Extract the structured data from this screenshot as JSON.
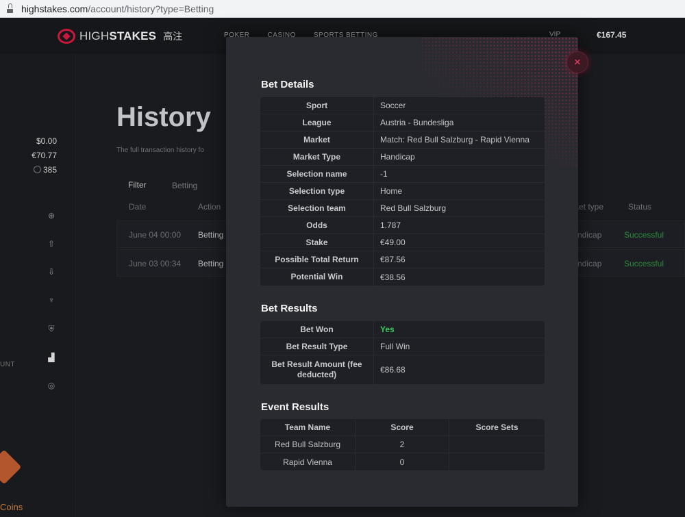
{
  "browser": {
    "url_host": "highstakes.com",
    "url_path": "/account/history?type=Betting"
  },
  "brand": {
    "name_light": "HIGH",
    "name_bold": "STAKES",
    "name_cn": "高注"
  },
  "nav": {
    "items": [
      "POKER",
      "CASINO",
      "SPORTS BETTING"
    ],
    "vip": "VIP",
    "balance": "€167.45"
  },
  "wallet": {
    "usd": "$0.00",
    "eur": "€70.77",
    "coins": "385"
  },
  "sidebar": {
    "account_label": "UNT",
    "coins_label": "Coins"
  },
  "page": {
    "title": "History",
    "subtitle": "The full transaction history fo",
    "filter_label": "Filter",
    "filter_value": "Betting",
    "columns": {
      "date": "Date",
      "action": "Action",
      "market_type": "ket type",
      "status": "Status"
    },
    "rows": [
      {
        "date": "June 04 00:00",
        "action": "Betting",
        "market": "ndicap",
        "status": "Successful"
      },
      {
        "date": "June 03 00:34",
        "action": "Betting",
        "market": "ndicap",
        "status": "Successful"
      }
    ]
  },
  "modal": {
    "close_symbol": "×",
    "bet_details": {
      "title": "Bet Details",
      "rows": [
        {
          "label": "Sport",
          "value": "Soccer"
        },
        {
          "label": "League",
          "value": "Austria - Bundesliga"
        },
        {
          "label": "Market",
          "value": "Match: Red Bull Salzburg - Rapid Vienna"
        },
        {
          "label": "Market Type",
          "value": "Handicap"
        },
        {
          "label": "Selection name",
          "value": "-1"
        },
        {
          "label": "Selection type",
          "value": "Home"
        },
        {
          "label": "Selection team",
          "value": "Red Bull Salzburg"
        },
        {
          "label": "Odds",
          "value": "1.787"
        },
        {
          "label": "Stake",
          "value": "€49.00"
        },
        {
          "label": "Possible Total Return",
          "value": "€87.56"
        },
        {
          "label": "Potential Win",
          "value": "€38.56"
        }
      ]
    },
    "bet_results": {
      "title": "Bet Results",
      "rows": [
        {
          "label": "Bet Won",
          "value": "Yes"
        },
        {
          "label": "Bet Result Type",
          "value": "Full Win"
        },
        {
          "label": "Bet Result Amount (fee deducted)",
          "value": "€86.68"
        }
      ]
    },
    "event_results": {
      "title": "Event Results",
      "headers": [
        "Team Name",
        "Score",
        "Score Sets"
      ],
      "rows": [
        {
          "team": "Red Bull Salzburg",
          "score": "2",
          "sets": ""
        },
        {
          "team": "Rapid Vienna",
          "score": "0",
          "sets": ""
        }
      ]
    }
  }
}
